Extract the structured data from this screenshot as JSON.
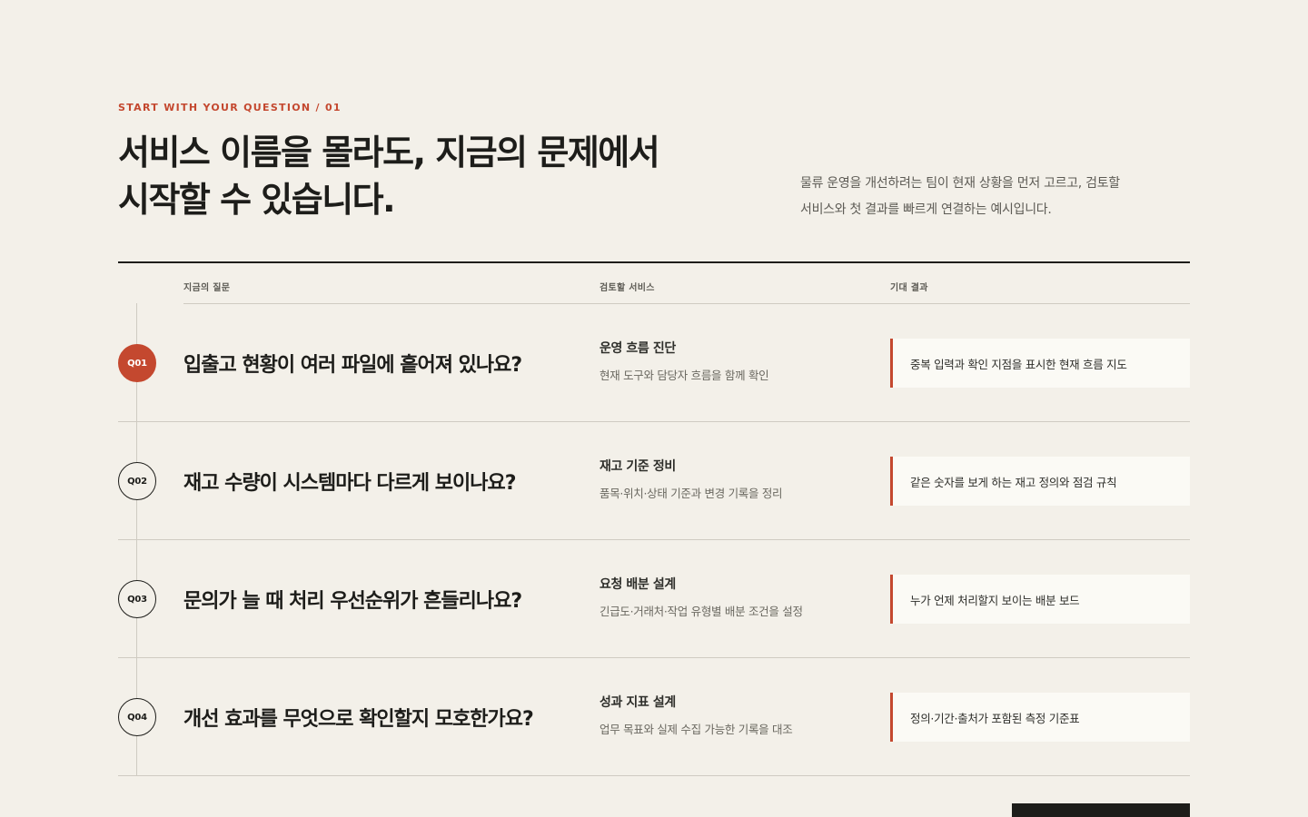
{
  "eyebrow": "START WITH YOUR QUESTION / 01",
  "title": {
    "line1": "서비스 이름을 몰라도, 지금의 문제에서",
    "line2": "시작할 수 있습니다."
  },
  "description": {
    "line1": "물류 운영을 개선하려는 팀이 현재 상황을 먼저 고르고, 검토할",
    "line2": "서비스와 첫 결과를 빠르게 연결하는 예시입니다."
  },
  "columns": {
    "question": "지금의 질문",
    "service": "검토할 서비스",
    "result": "기대 결과"
  },
  "rows": [
    {
      "badge": "Q01",
      "question": "입출고 현황이 여러 파일에 흩어져 있나요?",
      "service_name": "운영 흐름 진단",
      "service_desc": "현재 도구와 담당자 흐름을 함께 확인",
      "result": "중복 입력과 확인 지점을 표시한 현재 흐름 지도"
    },
    {
      "badge": "Q02",
      "question": "재고 수량이 시스템마다 다르게 보이나요?",
      "service_name": "재고 기준 정비",
      "service_desc": "품목·위치·상태 기준과 변경 기록을 정리",
      "result": "같은 숫자를 보게 하는 재고 정의와 점검 규칙"
    },
    {
      "badge": "Q03",
      "question": "문의가 늘 때 처리 우선순위가 흔들리나요?",
      "service_name": "요청 배분 설계",
      "service_desc": "긴급도·거래처·작업 유형별 배분 조건을 설정",
      "result": "누가 언제 처리할지 보이는 배분 보드"
    },
    {
      "badge": "Q04",
      "question": "개선 효과를 무엇으로 확인할지 모호한가요?",
      "service_name": "성과 지표 설계",
      "service_desc": "업무 목표와 실제 수집 가능한 기록을 대조",
      "result": "정의·기간·출처가 포함된 측정 기준표"
    }
  ],
  "active_row": "Q01",
  "colors": {
    "accent": "#c4482f",
    "background": "#f3f0e9",
    "ink": "#1d1d1a"
  }
}
